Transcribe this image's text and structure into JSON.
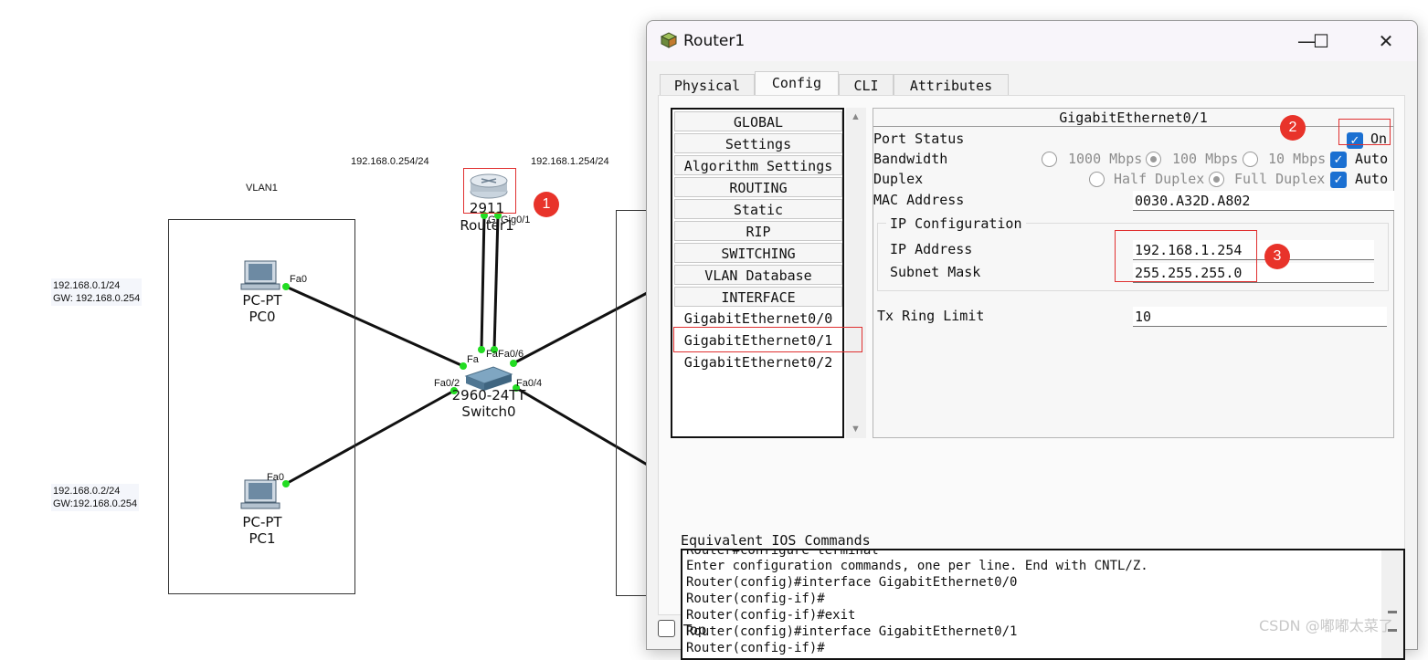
{
  "topology": {
    "vlan_label": "VLAN1",
    "router_ip_left": "192.168.0.254/24",
    "router_ip_right": "192.168.1.254/24",
    "router": {
      "model": "2911",
      "name": "Router1",
      "port_left": "G",
      "port_right": "Gig0/1"
    },
    "switch": {
      "model": "2960-24TT",
      "name": "Switch0",
      "ports": {
        "fa_top1": "Fa",
        "fa_top2": "Fa",
        "fa06": "Fa0/6",
        "fa02": "Fa0/2",
        "fa04": "Fa0/4"
      }
    },
    "pc0": {
      "type": "PC-PT",
      "name": "PC0",
      "port": "Fa0",
      "ip": "192.168.0.1/24",
      "gw": "GW:  192.168.0.254"
    },
    "pc1": {
      "type": "PC-PT",
      "name": "PC1",
      "port": "Fa0",
      "ip": "192.168.0.2/24",
      "gw": "GW:192.168.0.254"
    },
    "badges": [
      "1",
      "2",
      "3"
    ]
  },
  "window": {
    "title": "Router1",
    "controls": {
      "minimize": "—",
      "maximize": "☐",
      "close": "✕"
    },
    "tabs": [
      "Physical",
      "Config",
      "CLI",
      "Attributes"
    ],
    "active_tab": "Config",
    "sidebar": [
      "GLOBAL",
      "Settings",
      "Algorithm Settings",
      "ROUTING",
      "Static",
      "RIP",
      "SWITCHING",
      "VLAN Database",
      "INTERFACE",
      "GigabitEthernet0/0",
      "GigabitEthernet0/1",
      "GigabitEthernet0/2"
    ],
    "selected_item": "GigabitEthernet0/1",
    "config": {
      "header": "GigabitEthernet0/1",
      "port_status_label": "Port Status",
      "port_status_on": "On",
      "bandwidth_label": "Bandwidth",
      "bandwidth_options": [
        "1000 Mbps",
        "100 Mbps",
        "10 Mbps"
      ],
      "bandwidth_auto": "Auto",
      "duplex_label": "Duplex",
      "duplex_options": [
        "Half Duplex",
        "Full Duplex"
      ],
      "duplex_auto": "Auto",
      "mac_label": "MAC Address",
      "mac_value": "0030.A32D.A802",
      "ip_group_label": "IP Configuration",
      "ip_label": "IP Address",
      "ip_value": "192.168.1.254",
      "mask_label": "Subnet Mask",
      "mask_value": "255.255.255.0",
      "tx_label": "Tx Ring Limit",
      "tx_value": "10"
    },
    "ios_label": "Equivalent IOS Commands",
    "ios_lines": [
      "Router#configure terminal",
      "Enter configuration commands, one per line.  End with CNTL/Z.",
      "Router(config)#interface GigabitEthernet0/0",
      "Router(config-if)#",
      "Router(config-if)#exit",
      "Router(config)#interface GigabitEthernet0/1",
      "Router(config-if)#"
    ],
    "top_label": "Top"
  },
  "watermark": "CSDN @嘟嘟太菜了"
}
